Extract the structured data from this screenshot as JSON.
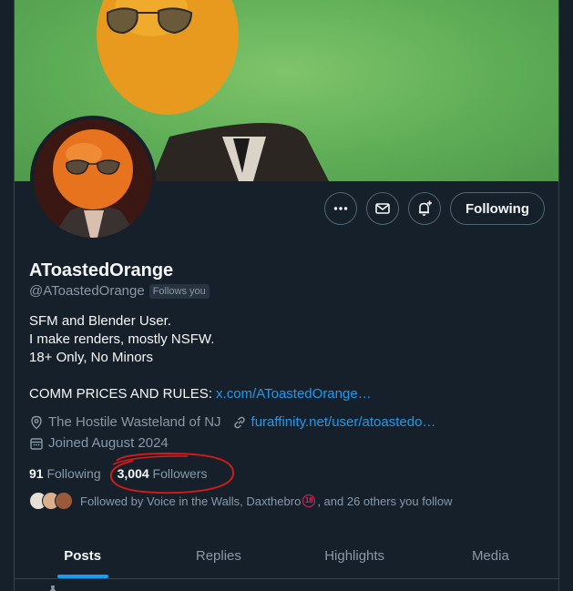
{
  "profile": {
    "display_name": "AToastedOrange",
    "handle": "@AToastedOrange",
    "follows_you_badge": "Follows you",
    "bio_lines": [
      "SFM and Blender User.",
      "I make renders, mostly NSFW.",
      "18+ Only, No Minors"
    ],
    "comm_label": "COMM PRICES AND RULES: ",
    "comm_link": "x.com/AToastedOrange…",
    "location": "The Hostile Wasteland of NJ",
    "website": "furaffinity.net/user/atoastedo…",
    "joined": "Joined August 2024"
  },
  "actions": {
    "more_icon": "more-horizontal-icon",
    "message_icon": "mail-icon",
    "notify_icon": "bell-plus-icon",
    "follow_label": "Following"
  },
  "stats": {
    "following_count": "91",
    "following_label": " Following",
    "followers_count": "3,004",
    "followers_label": " Followers"
  },
  "followed_by": {
    "prefix": "Followed by Voice in the Walls, Daxthebro ",
    "badge": "18",
    "suffix": ", and 26 others you follow"
  },
  "tabs": [
    {
      "label": "Posts",
      "active": true
    },
    {
      "label": "Replies",
      "active": false
    },
    {
      "label": "Highlights",
      "active": false
    },
    {
      "label": "Media",
      "active": false
    }
  ],
  "colors": {
    "background": "#15202b",
    "accent": "#1d9bf0",
    "annotation": "#d11a1a"
  }
}
